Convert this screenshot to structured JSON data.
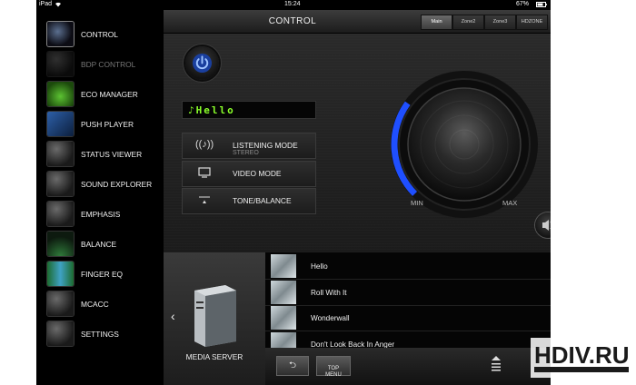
{
  "status_bar": {
    "device": "iPad",
    "time": "15:24",
    "battery": "67%"
  },
  "sidebar": {
    "items": [
      {
        "label": "CONTROL",
        "icon": "knob-thumb-icon",
        "state": "active"
      },
      {
        "label": "BDP CONTROL",
        "icon": "bdp-thumb-icon",
        "state": "disabled"
      },
      {
        "label": "ECO MANAGER",
        "icon": "leaf-thumb-icon",
        "state": "normal"
      },
      {
        "label": "PUSH PLAYER",
        "icon": "music-note-thumb-icon",
        "state": "normal"
      },
      {
        "label": "STATUS VIEWER",
        "icon": "status-thumb-icon",
        "state": "normal"
      },
      {
        "label": "SOUND EXPLORER",
        "icon": "speakers-thumb-icon",
        "state": "normal"
      },
      {
        "label": "EMPHASIS",
        "icon": "emphasis-thumb-icon",
        "state": "normal"
      },
      {
        "label": "BALANCE",
        "icon": "balance-thumb-icon",
        "state": "normal"
      },
      {
        "label": "FINGER EQ",
        "icon": "eq-thumb-icon",
        "state": "normal"
      },
      {
        "label": "MCACC",
        "icon": "mcacc-thumb-icon",
        "state": "normal"
      },
      {
        "label": "SETTINGS",
        "icon": "gear-thumb-icon",
        "state": "normal"
      }
    ]
  },
  "header": {
    "title": "CONTROL",
    "zone_tabs": [
      {
        "label": "Main",
        "active": true
      },
      {
        "label": "Zone2",
        "active": false
      },
      {
        "label": "Zone3",
        "active": false
      },
      {
        "label": "HDZONE",
        "active": false
      }
    ]
  },
  "control": {
    "display_text": "♪Hello",
    "buttons": [
      {
        "label": "LISTENING MODE",
        "sub": "STEREO",
        "icon": "listening-mode-icon"
      },
      {
        "label": "VIDEO MODE",
        "sub": "",
        "icon": "monitor-icon"
      },
      {
        "label": "TONE/BALANCE",
        "sub": "",
        "icon": "tone-balance-icon"
      }
    ],
    "volume": {
      "min_label": "MIN",
      "max_label": "MAX",
      "level": 0.3
    },
    "colors": {
      "accent": "#1f4fff",
      "display_text": "#8aff2a"
    }
  },
  "media": {
    "source": "MEDIA SERVER",
    "tracks": [
      {
        "title": "Hello"
      },
      {
        "title": "Roll With It"
      },
      {
        "title": "Wonderwall"
      },
      {
        "title": "Don't Look Back In Anger"
      }
    ],
    "top_menu_label": "TOP\nMENU",
    "return_symbol": "⮌"
  },
  "watermark": {
    "brand": "HDIV.RU"
  }
}
